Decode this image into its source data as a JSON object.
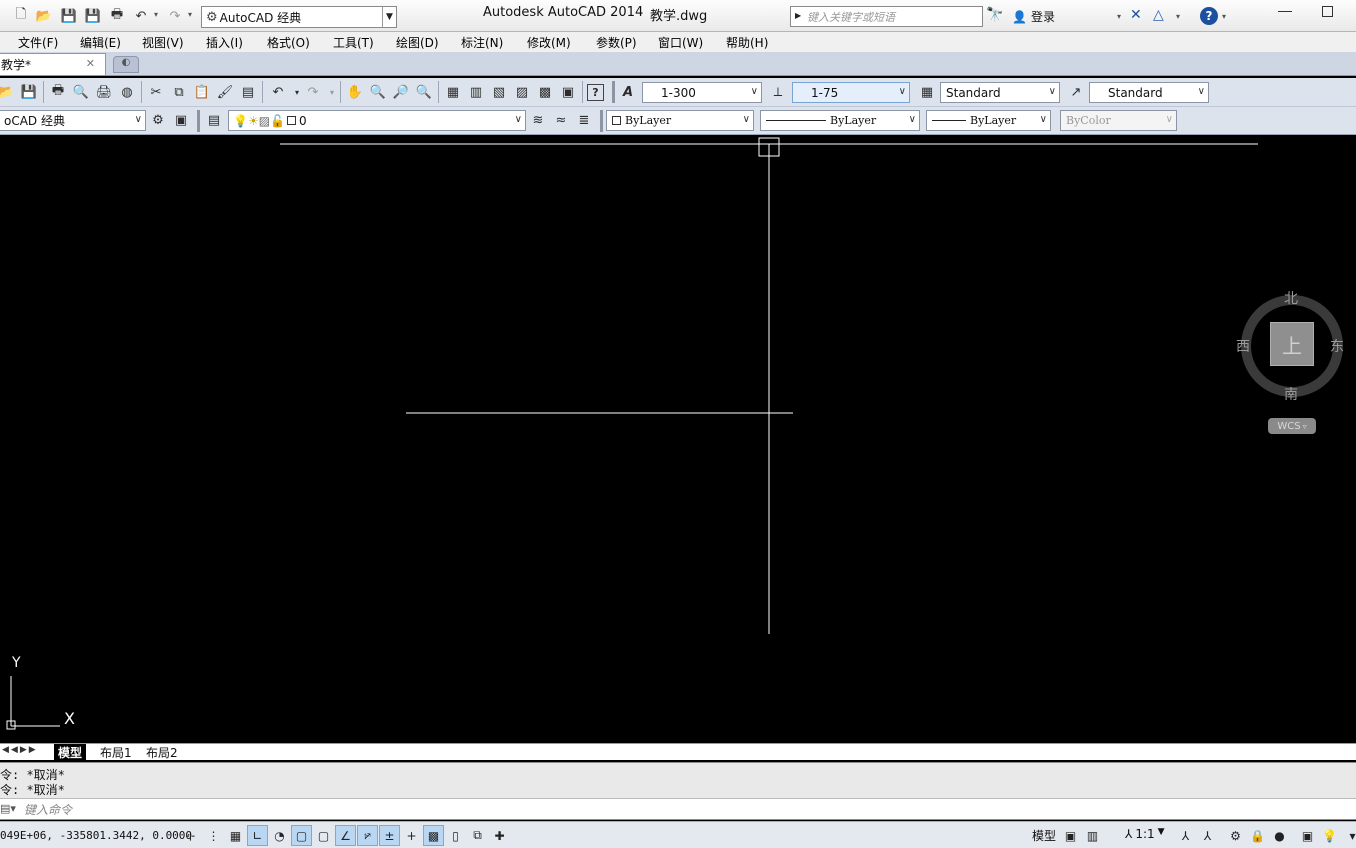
{
  "title_bar": {
    "workspace": "AutoCAD 经典",
    "app_title": "Autodesk AutoCAD 2014",
    "file_name": "教学.dwg",
    "search_placeholder": "键入关键字或短语",
    "login_label": "登录"
  },
  "menu": [
    "文件(F)",
    "编辑(E)",
    "视图(V)",
    "插入(I)",
    "格式(O)",
    "工具(T)",
    "绘图(D)",
    "标注(N)",
    "修改(M)",
    "参数(P)",
    "窗口(W)",
    "帮助(H)"
  ],
  "document_tab": {
    "label": "教学*"
  },
  "toolbar": {
    "text_style_value": "1-300",
    "dim_style_value": "1-75",
    "table_style_value": "Standard",
    "mleader_style_value": "Standard",
    "workspace2": "oCAD 经典",
    "layer_value": "0",
    "color_value": "ByLayer",
    "linetype_value": "ByLayer",
    "lineweight_value": "ByLayer",
    "plotstyle_value": "ByColor"
  },
  "viewcube": {
    "north": "北",
    "south": "南",
    "east": "东",
    "west": "西",
    "face": "上",
    "wcs": "WCS"
  },
  "ucs": {
    "y_label": "Y",
    "x_label": "X"
  },
  "layout_tabs": [
    "模型",
    "布局1",
    "布局2"
  ],
  "command": {
    "history": [
      "令: *取消*",
      "令: *取消*"
    ],
    "input_placeholder": "键入命令"
  },
  "status": {
    "coords": "049E+06, -335801.3442, 0.0000",
    "model_label": "模型",
    "annotation_scale": "1:1"
  },
  "colors": {
    "canvas": "#000000",
    "crosshair": "#ffffff",
    "toolbar_bg": "#dde3ed"
  }
}
